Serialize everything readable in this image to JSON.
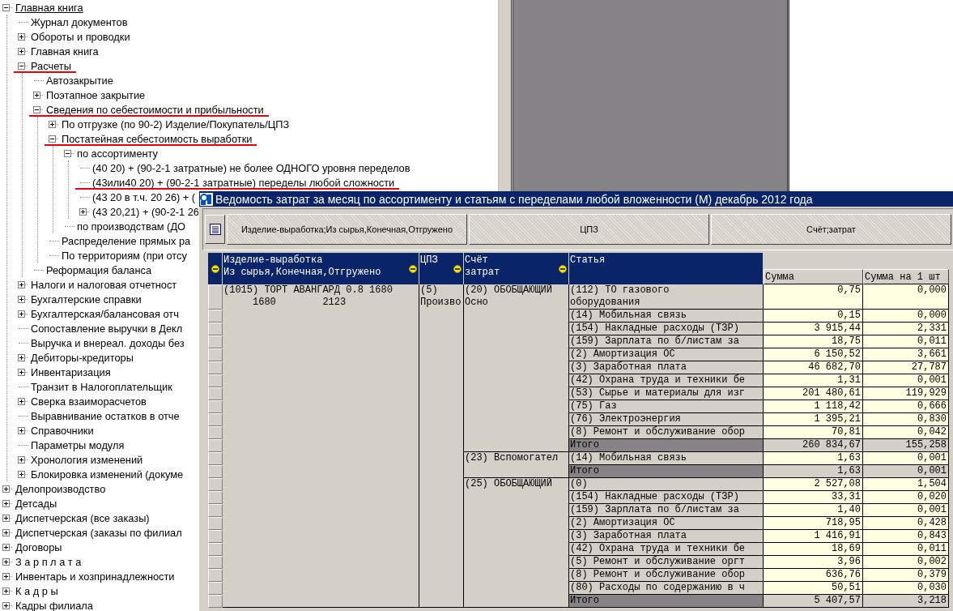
{
  "tree": [
    {
      "label": "Главная книга",
      "selected": true,
      "marked": false,
      "expanded": true,
      "children": [
        {
          "label": "Журнал документов",
          "selected": false,
          "marked": false
        },
        {
          "label": "Обороты и проводки",
          "selected": false,
          "marked": false,
          "expanded": false
        },
        {
          "label": "Главная книга",
          "selected": false,
          "marked": false,
          "expanded": false
        },
        {
          "label": "Расчеты",
          "selected": false,
          "marked": true,
          "expanded": true,
          "children": [
            {
              "label": "Автозакрытие",
              "selected": false,
              "marked": false
            },
            {
              "label": "Поэтапное закрытие",
              "selected": false,
              "marked": false,
              "expanded": false
            },
            {
              "label": "Сведения по себестоимости и прибыльности",
              "selected": false,
              "marked": true,
              "expanded": true,
              "children": [
                {
                  "label": "По отгрузке (по 90-2) Изделие/Покупатель/ЦПЗ",
                  "selected": false,
                  "marked": false,
                  "expanded": false
                },
                {
                  "label": "Постатейная себестоимость выработки",
                  "selected": false,
                  "marked": true,
                  "expanded": true,
                  "children": [
                    {
                      "label": "по ассортименту",
                      "selected": false,
                      "marked": false,
                      "expanded": true,
                      "children": [
                        {
                          "label": "(40 20) + (90-2-1 затратные) не более ОДНОГО уровня переделов",
                          "selected": false,
                          "marked": false
                        },
                        {
                          "label": "(43или40 20) + (90-2-1 затратные) переделы любой сложности",
                          "selected": false,
                          "marked": true
                        },
                        {
                          "label": "(43 20 в т.ч. 20 26) + (",
                          "selected": false,
                          "marked": false
                        },
                        {
                          "label": "(43 20,21) + (90-2-1 26",
                          "selected": false,
                          "marked": false,
                          "expanded": false
                        }
                      ]
                    },
                    {
                      "label": "по производствам (ДО",
                      "selected": false,
                      "marked": false
                    }
                  ]
                },
                {
                  "label": "Распределение прямых ра",
                  "selected": false,
                  "marked": false
                },
                {
                  "label": "По территориям (при отсу",
                  "selected": false,
                  "marked": false
                }
              ]
            },
            {
              "label": "Реформация баланса",
              "selected": false,
              "marked": false
            }
          ]
        },
        {
          "label": "Налоги и налоговая отчетност",
          "selected": false,
          "marked": false,
          "expanded": false
        },
        {
          "label": "Бухгалтерские справки",
          "selected": false,
          "marked": false,
          "expanded": false
        },
        {
          "label": "Бухгалтерская/балансовая  отч",
          "selected": false,
          "marked": false,
          "expanded": false
        },
        {
          "label": "Сопоставление выручки в Декл",
          "selected": false,
          "marked": false
        },
        {
          "label": "Выручка и внереал. доходы без",
          "selected": false,
          "marked": false
        },
        {
          "label": "Дебиторы-кредиторы",
          "selected": false,
          "marked": false,
          "expanded": false
        },
        {
          "label": "Инвентаризация",
          "selected": false,
          "marked": false,
          "expanded": false
        },
        {
          "label": "Транзит в Налогоплательщик",
          "selected": false,
          "marked": false
        },
        {
          "label": "Сверка взаиморасчетов",
          "selected": false,
          "marked": false,
          "expanded": false
        },
        {
          "label": "Выравнивание остатков в отче",
          "selected": false,
          "marked": false
        },
        {
          "label": "Справочники",
          "selected": false,
          "marked": false,
          "expanded": false
        },
        {
          "label": "Параметры модуля",
          "selected": false,
          "marked": false
        },
        {
          "label": "Хронология изменений",
          "selected": false,
          "marked": false,
          "expanded": false
        },
        {
          "label": "Блокировка изменений (докуме",
          "selected": false,
          "marked": false,
          "expanded": false
        }
      ]
    },
    {
      "label": "Делопроизводство",
      "selected": false,
      "marked": false,
      "expanded": false
    },
    {
      "label": "Детсады",
      "selected": false,
      "marked": false,
      "expanded": false
    },
    {
      "label": "Диспетчерская (все заказы)",
      "selected": false,
      "marked": false,
      "expanded": false
    },
    {
      "label": "Диспетчерская (заказы по филиал",
      "selected": false,
      "marked": false,
      "expanded": false
    },
    {
      "label": "Договоры",
      "selected": false,
      "marked": false,
      "expanded": false
    },
    {
      "label": "З а р п л а т а",
      "selected": false,
      "marked": false,
      "expanded": false
    },
    {
      "label": "Инвентарь и хозпринадлежности",
      "selected": false,
      "marked": false,
      "expanded": false
    },
    {
      "label": "К а д р ы",
      "selected": false,
      "marked": false,
      "expanded": false
    },
    {
      "label": "Кадры филиала",
      "selected": false,
      "marked": false,
      "expanded": false
    }
  ],
  "report_window": {
    "title": "Ведомость затрат за месяц по ассортименту и статьям с переделами любой вложенности (М) декабрь 2012 года",
    "group_buttons": [
      "Изделие-выработка;Из сырья,Конечная,Отгружено",
      "ЦПЗ",
      "Счёт;затрат"
    ],
    "columns": [
      {
        "label": "Изделие-выработка\nИз сырья,Конечная,Отгружено",
        "grouped": true
      },
      {
        "label": "ЦПЗ",
        "grouped": true
      },
      {
        "label": "Счёт\nзатрат",
        "grouped": true
      },
      {
        "label": "Статья",
        "grouped": false
      }
    ],
    "value_columns": [
      "Сумма",
      "Сумма на 1 шт"
    ],
    "product": "(1015) ТОРТ АВАНГАРД 0.8 1680\n     1680        2123",
    "cpz": "(5)\nПроизво",
    "accounts": [
      {
        "label": "(20) ОБОБЩАЮЩИЙ\nОсно",
        "rows": [
          {
            "kind": "item",
            "article": "(112) ТО газового\nоборудования",
            "sum": "0,75",
            "per_unit": "0,000"
          },
          {
            "kind": "item",
            "article": "(14) Мобильная связь",
            "sum": "0,15",
            "per_unit": "0,000"
          },
          {
            "kind": "item",
            "article": "(154) Накладные расходы (ТЗР)",
            "sum": "3 915,44",
            "per_unit": "2,331"
          },
          {
            "kind": "item",
            "article": "(159) Зарплата по б/листам за",
            "sum": "18,75",
            "per_unit": "0,011"
          },
          {
            "kind": "item",
            "article": "(2) Амортизация ОС",
            "sum": "6 150,52",
            "per_unit": "3,661"
          },
          {
            "kind": "item",
            "article": "(3) Заработная плата",
            "sum": "46 682,70",
            "per_unit": "27,787"
          },
          {
            "kind": "item",
            "article": "(42) Охрана труда и техники бе",
            "sum": "1,31",
            "per_unit": "0,001"
          },
          {
            "kind": "item",
            "article": "(53) Сырье и материалы для изг",
            "sum": "201 480,61",
            "per_unit": "119,929"
          },
          {
            "kind": "item",
            "article": "(75) Газ",
            "sum": "1 118,42",
            "per_unit": "0,666"
          },
          {
            "kind": "item",
            "article": "(76) Электроэнергия",
            "sum": "1 395,21",
            "per_unit": "0,830"
          },
          {
            "kind": "item",
            "article": "(8) Ремонт и обслуживание обор",
            "sum": "70,81",
            "per_unit": "0,042"
          },
          {
            "kind": "total",
            "article": "Итого",
            "sum": "260 834,67",
            "per_unit": "155,258"
          }
        ]
      },
      {
        "label": "(23) Вспомогател",
        "rows": [
          {
            "kind": "item",
            "article": "(14) Мобильная связь",
            "sum": "1,63",
            "per_unit": "0,001"
          },
          {
            "kind": "total",
            "article": "Итого",
            "sum": "1,63",
            "per_unit": "0,001"
          }
        ]
      },
      {
        "label": "(25) ОБОБЩАЮЩИЙ",
        "rows": [
          {
            "kind": "item",
            "article": "(0)",
            "sum": "2 527,08",
            "per_unit": "1,504"
          },
          {
            "kind": "item",
            "article": "(154) Накладные расходы (ТЗР)",
            "sum": "33,31",
            "per_unit": "0,020"
          },
          {
            "kind": "item",
            "article": "(159) Зарплата по б/листам за",
            "sum": "1,40",
            "per_unit": "0,001"
          },
          {
            "kind": "item",
            "article": "(2) Амортизация ОС",
            "sum": "718,95",
            "per_unit": "0,428"
          },
          {
            "kind": "item",
            "article": "(3) Заработная плата",
            "sum": "1 416,91",
            "per_unit": "0,843"
          },
          {
            "kind": "item",
            "article": "(42) Охрана труда и техники бе",
            "sum": "18,69",
            "per_unit": "0,011"
          },
          {
            "kind": "item",
            "article": "(5) Ремонт и обслуживание оргт",
            "sum": "3,96",
            "per_unit": "0,002"
          },
          {
            "kind": "item",
            "article": "(8) Ремонт и обслуживание обор",
            "sum": "636,76",
            "per_unit": "0,379"
          },
          {
            "kind": "item",
            "article": "(80) Расходы по содержанию в ч",
            "sum": "50,51",
            "per_unit": "0,030"
          },
          {
            "kind": "total",
            "article": "Итого",
            "sum": "5 407,57",
            "per_unit": "3,218"
          }
        ]
      }
    ]
  }
}
